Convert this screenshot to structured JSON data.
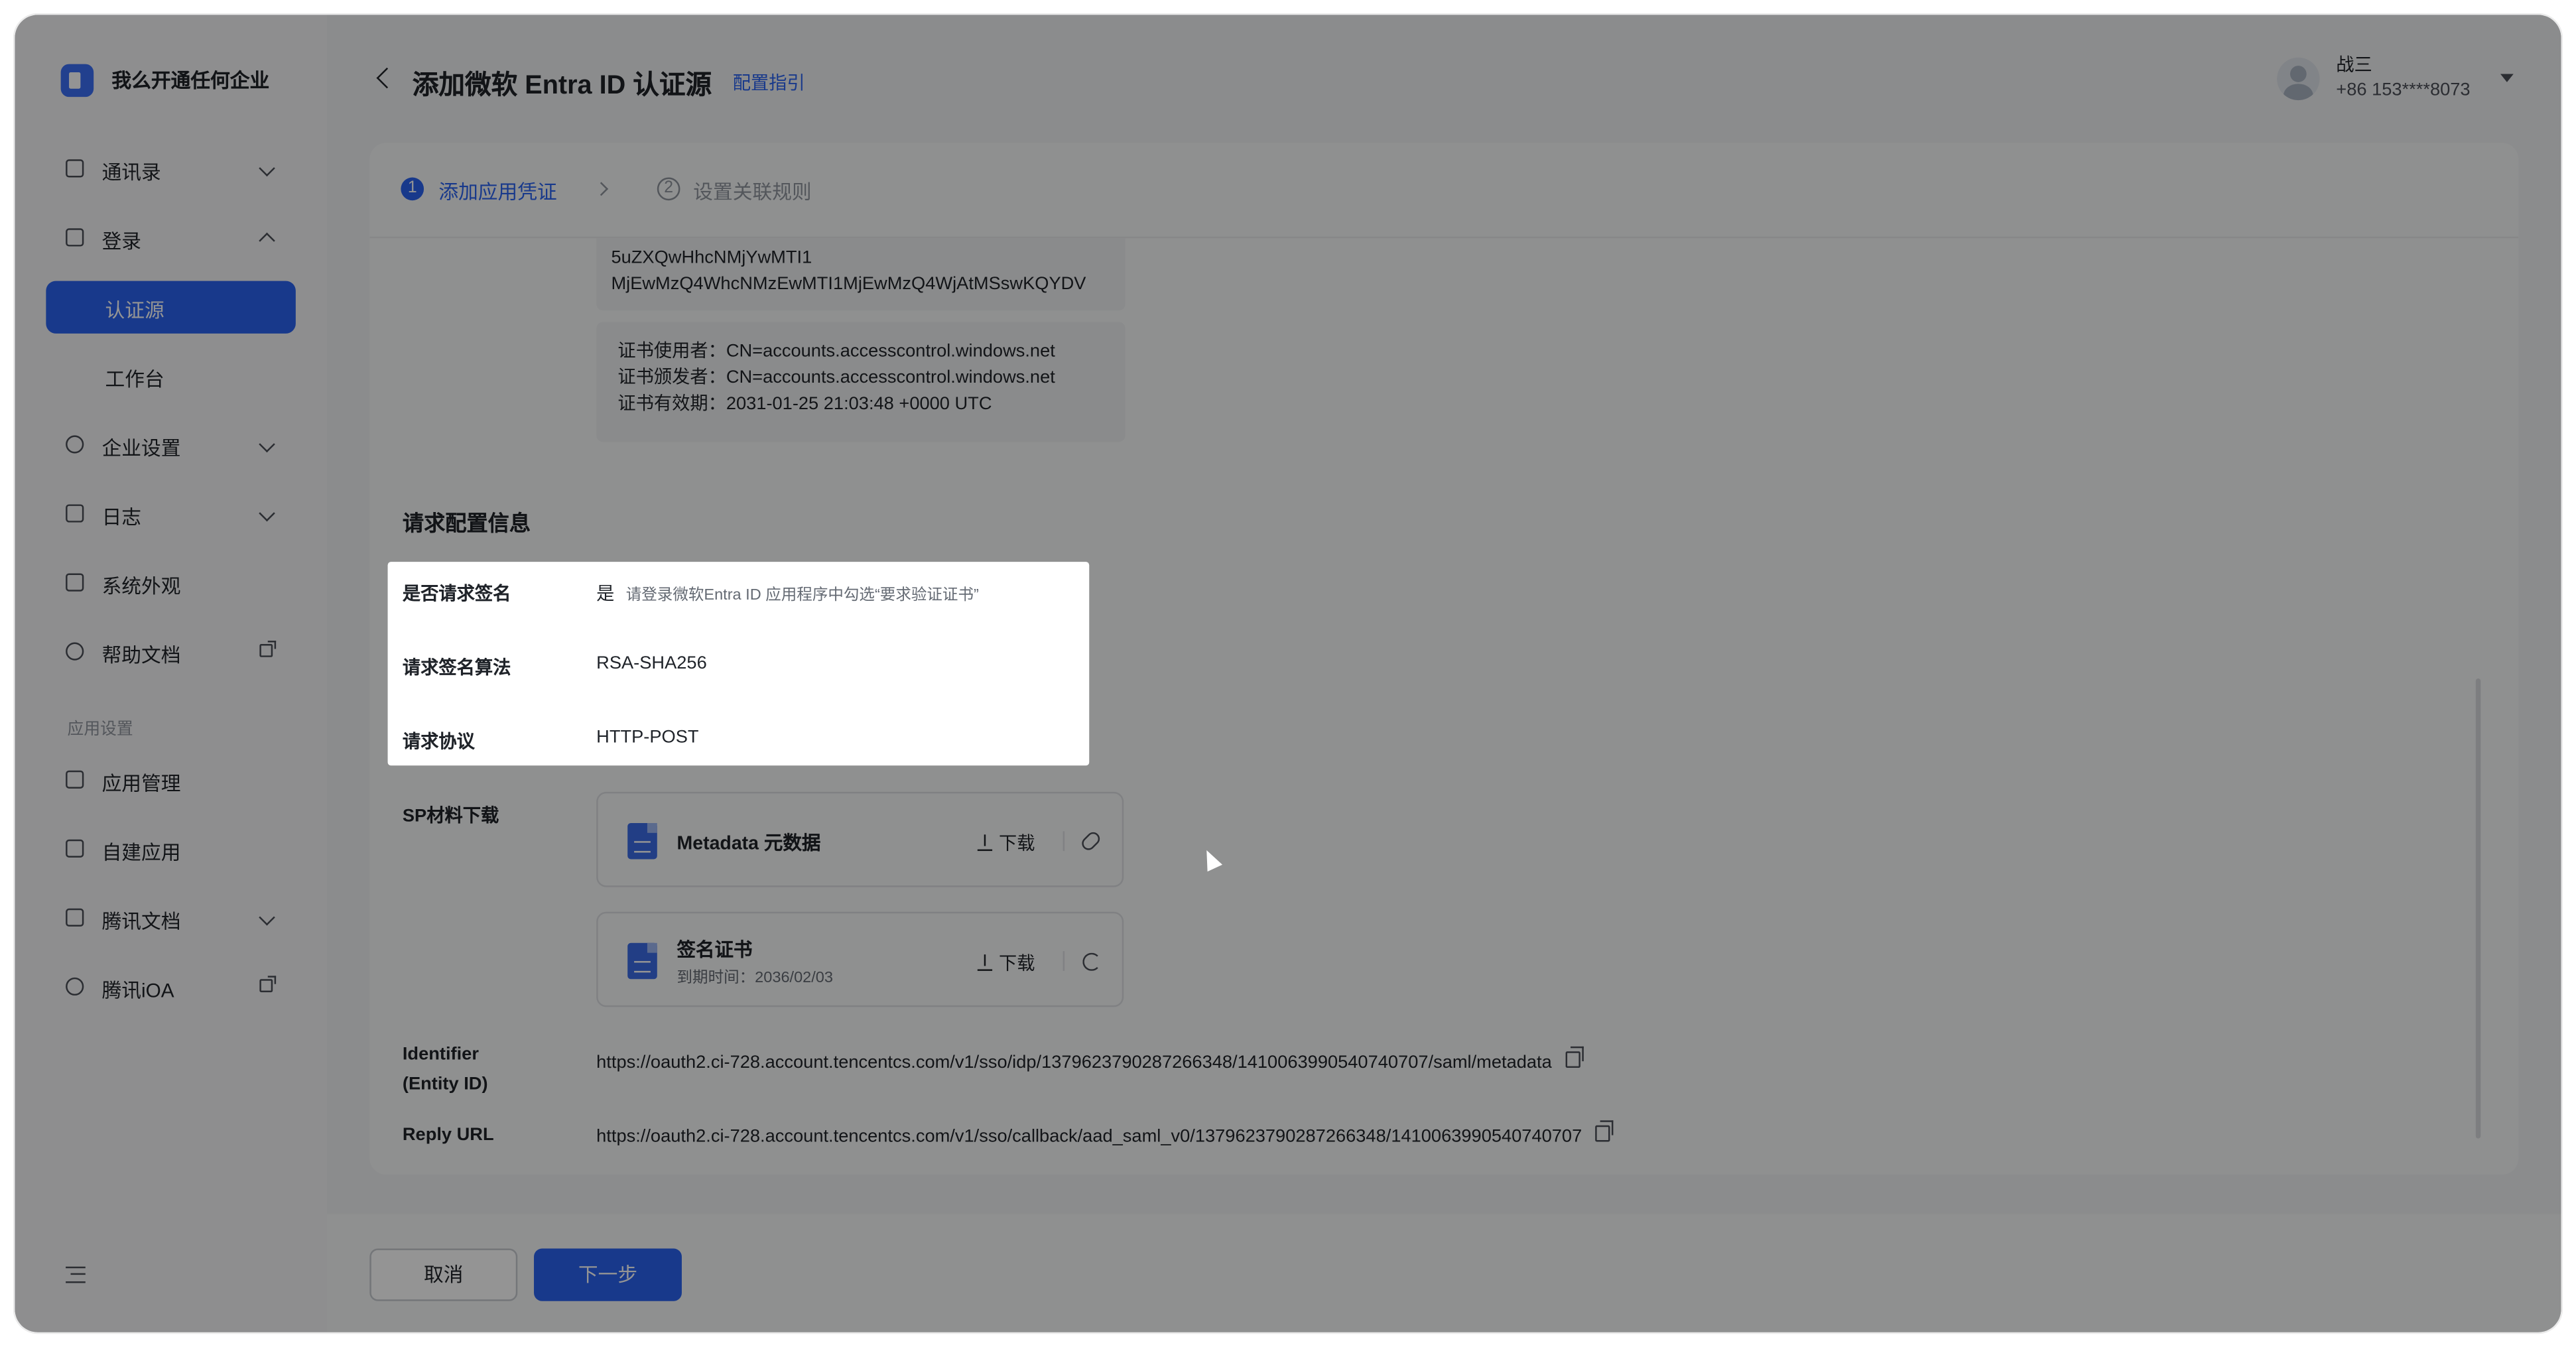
{
  "workspace": {
    "name": "我么开通任何企业"
  },
  "sidebar": {
    "items": [
      {
        "label": "通讯录",
        "icon": "contacts-icon",
        "chevron": "down"
      },
      {
        "label": "登录",
        "icon": "login-icon",
        "chevron": "up"
      },
      {
        "label": "企业设置",
        "icon": "settings-icon",
        "chevron": "down"
      },
      {
        "label": "日志",
        "icon": "log-icon",
        "chevron": "down"
      },
      {
        "label": "系统外观",
        "icon": "appearance-icon"
      },
      {
        "label": "帮助文档",
        "icon": "help-icon",
        "external": true
      },
      {
        "label": "应用管理",
        "icon": "app-manage-icon"
      },
      {
        "label": "自建应用",
        "icon": "custom-app-icon"
      },
      {
        "label": "腾讯文档",
        "icon": "tencent-docs-icon",
        "chevron": "down"
      },
      {
        "label": "腾讯iOA",
        "icon": "tencent-ioa-icon",
        "external": true
      }
    ],
    "sub_items": [
      {
        "label": "认证源",
        "active": true
      },
      {
        "label": "工作台",
        "active": false
      }
    ],
    "section_label": "应用设置"
  },
  "header": {
    "title": "添加微软 Entra ID 认证源",
    "guide_link": "配置指引",
    "user": {
      "name": "战三",
      "phone": "+86 153****8073"
    }
  },
  "steps": [
    {
      "num": "1",
      "label": "添加应用凭证",
      "active": true
    },
    {
      "num": "2",
      "label": "设置关联规则",
      "active": false
    }
  ],
  "certificate": {
    "lines": [
      "5uZXQwHhcNMjYwMTI1",
      "MjEwMzQ4WhcNMzEwMTI1MjEwMzQ4WjAtMSswKQYDV"
    ],
    "info": [
      "证书使用者：CN=accounts.accesscontrol.windows.net",
      "证书颁发者：CN=accounts.accesscontrol.windows.net",
      "证书有效期：2031-01-25 21:03:48 +0000 UTC"
    ]
  },
  "request_config": {
    "section_title": "请求配置信息",
    "fields": [
      {
        "label": "是否请求签名",
        "value": "是",
        "hint": "请登录微软Entra ID 应用程序中勾选“要求验证证书”"
      },
      {
        "label": "请求签名算法",
        "value": "RSA-SHA256"
      },
      {
        "label": "请求协议",
        "value": "HTTP-POST"
      }
    ]
  },
  "sp_download": {
    "label": "SP材料下载",
    "files": [
      {
        "name": "Metadata 元数据",
        "action": "下载"
      },
      {
        "name": "签名证书",
        "expiry": "到期时间：2036/02/03",
        "action": "下载"
      }
    ]
  },
  "identifier": {
    "label_line1": "Identifier",
    "label_line2": "(Entity ID)",
    "value": "https://oauth2.ci-728.account.tencentcs.com/v1/sso/idp/1379623790287266348/1410063990540740707/saml/metadata"
  },
  "reply_url": {
    "label": "Reply URL",
    "value": "https://oauth2.ci-728.account.tencentcs.com/v1/sso/callback/aad_saml_v0/1379623790287266348/1410063990540740707"
  },
  "footer": {
    "cancel": "取消",
    "next": "下一步"
  },
  "colors": {
    "accent": "#2a63ef",
    "overlay": "rgba(0,0,0,0.42)"
  }
}
